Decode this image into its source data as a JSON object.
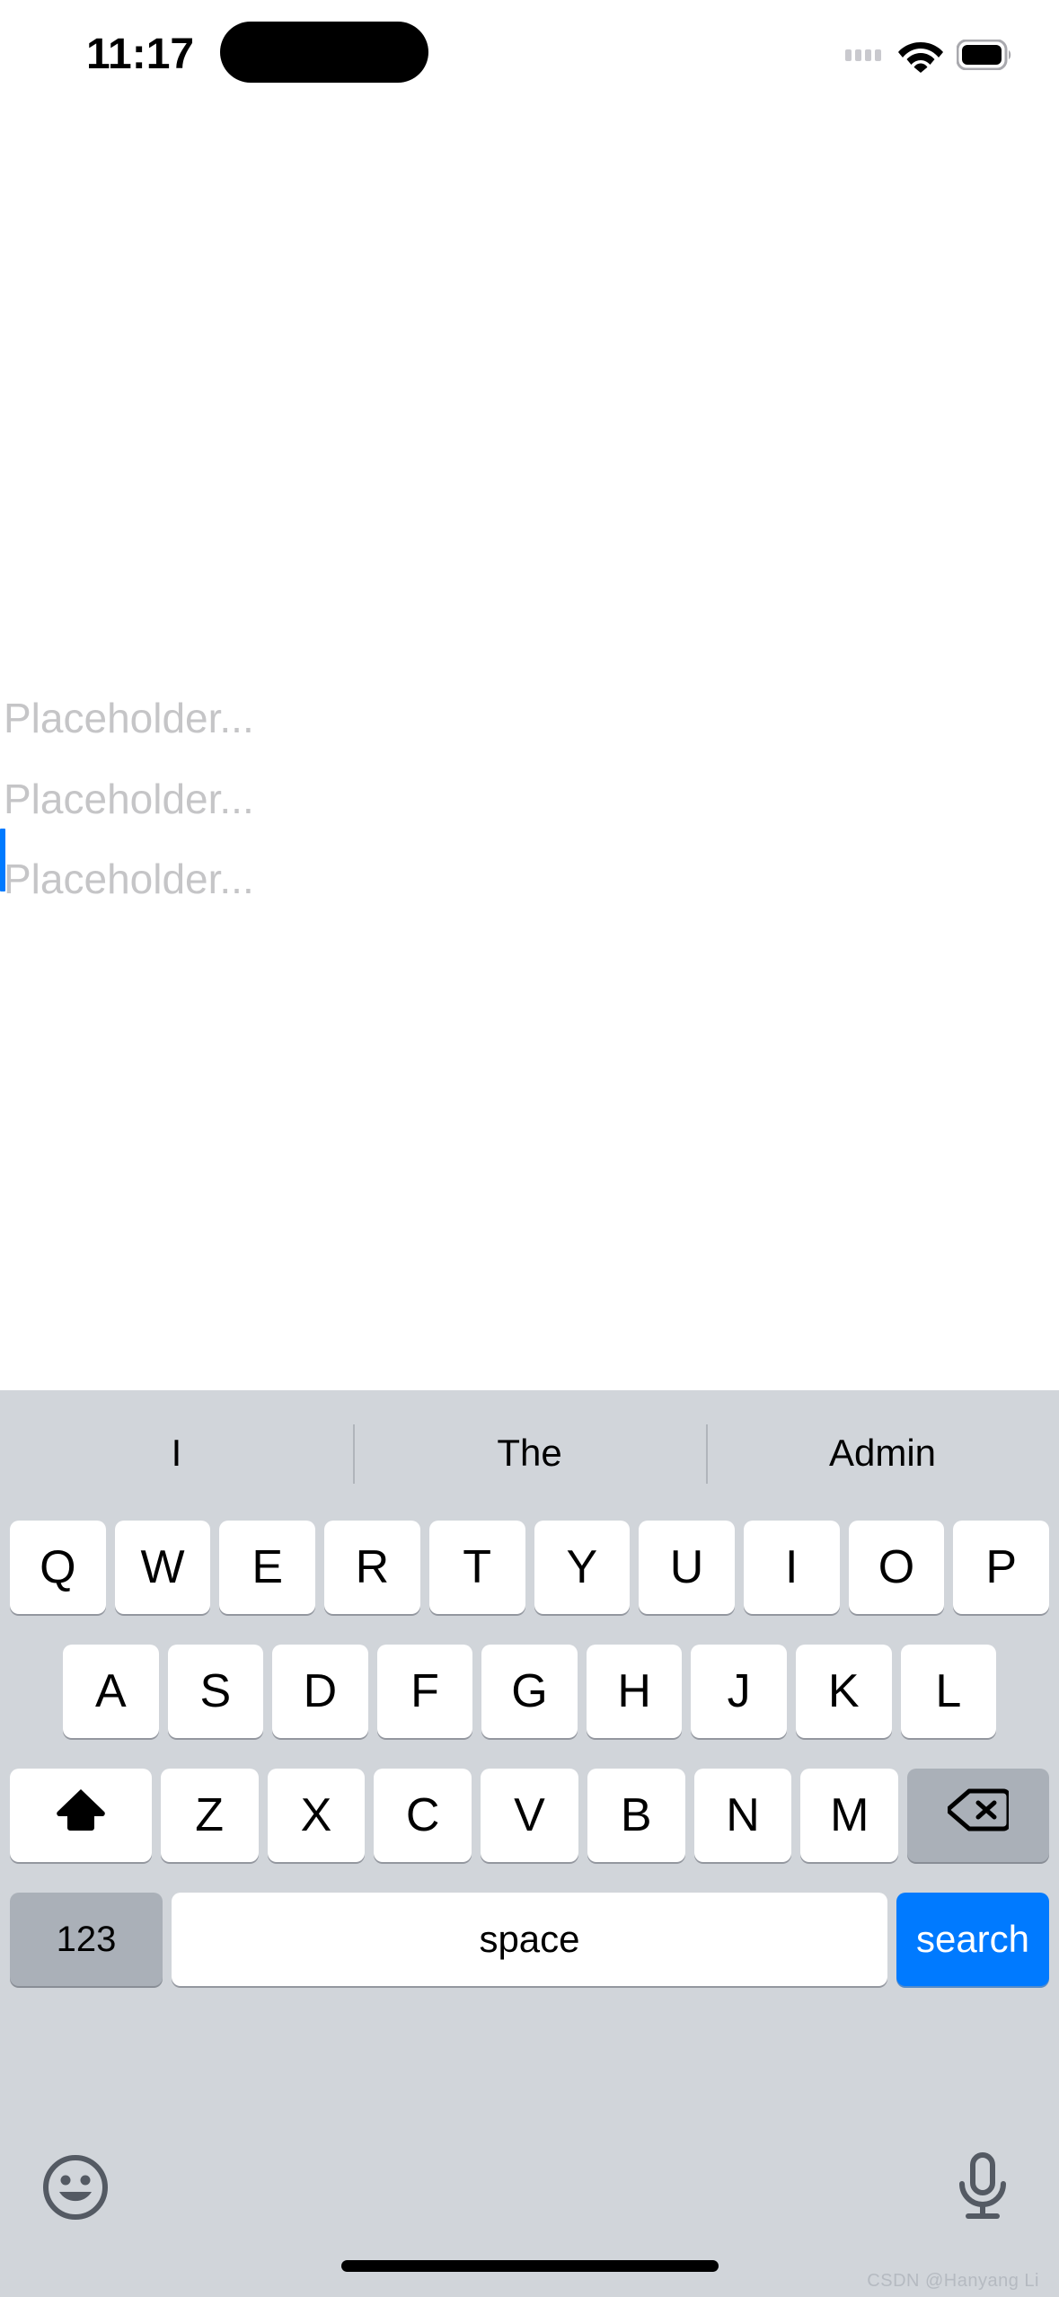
{
  "status_bar": {
    "time": "11:17",
    "signal_icon": "signal-dots-icon",
    "wifi_icon": "wifi-icon",
    "battery_icon": "battery-icon",
    "dynamic_island": "dynamic-island"
  },
  "content": {
    "fields": [
      {
        "placeholder": "Placeholder..."
      },
      {
        "placeholder": "Placeholder..."
      },
      {
        "placeholder": "Placeholder..."
      }
    ],
    "focused_field_index": 2,
    "caret_color": "#007aff"
  },
  "keyboard": {
    "background": "#d1d5da",
    "suggestions": [
      "I",
      "The",
      "Admin"
    ],
    "rows": {
      "row1": [
        "Q",
        "W",
        "E",
        "R",
        "T",
        "Y",
        "U",
        "I",
        "O",
        "P"
      ],
      "row2": [
        "A",
        "S",
        "D",
        "F",
        "G",
        "H",
        "J",
        "K",
        "L"
      ],
      "row3_letters": [
        "Z",
        "X",
        "C",
        "V",
        "B",
        "N",
        "M"
      ],
      "shift_icon": "shift-icon",
      "delete_icon": "backspace-icon"
    },
    "bottom_row": {
      "numbers_label": "123",
      "space_label": "space",
      "return_label": "search",
      "return_color": "#007aff"
    },
    "utility_row": {
      "emoji_icon": "emoji-smiley-icon",
      "mic_icon": "microphone-icon"
    }
  },
  "home_indicator": "home-indicator",
  "watermark": "CSDN @Hanyang Li"
}
